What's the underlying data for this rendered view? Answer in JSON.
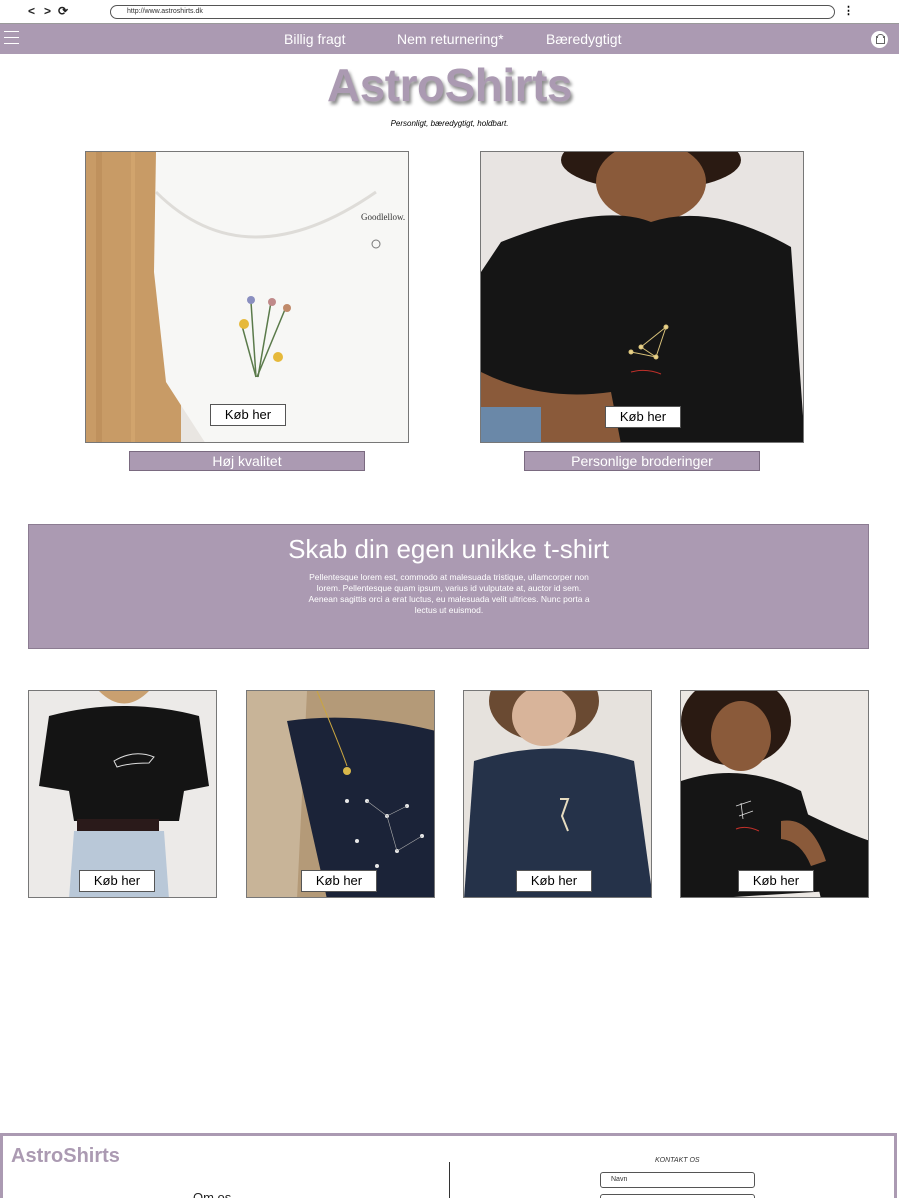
{
  "browser": {
    "back": "<",
    "forward": ">",
    "reload": "⟳",
    "url": "http://www.astroshirts.dk",
    "menu": "⋮"
  },
  "nav": {
    "links": [
      "Billig fragt",
      "Nem returnering*",
      "Bæredygtigt"
    ]
  },
  "brand": {
    "logo": "AstroShirts",
    "tagline": "Personligt, bæredygtigt, holdbart."
  },
  "featured": [
    {
      "button": "Køb her",
      "caption": "Høj kvalitet"
    },
    {
      "button": "Køb her",
      "caption": "Personlige broderinger"
    }
  ],
  "banner": {
    "title": "Skab din egen unikke t-shirt",
    "body": "Pellentesque lorem est, commodo at malesuada tristique, ullamcorper non lorem. Pellentesque quam ipsum, varius id vulputate at, auctor id sem. Aenean sagittis orci a erat luctus, eu malesuada velit ultrices. Nunc porta a lectus ut euismod."
  },
  "products": [
    {
      "button": "Køb her"
    },
    {
      "button": "Køb her"
    },
    {
      "button": "Køb her"
    },
    {
      "button": "Køb her"
    }
  ],
  "footer": {
    "logo": "AstroShirts",
    "about": "Om os",
    "contact_title": "KONTAKT OS",
    "name_placeholder": "Navn"
  },
  "colors": {
    "accent": "#ab9ab2"
  },
  "icons": [
    "back-icon",
    "forward-icon",
    "reload-icon",
    "kebab-menu-icon",
    "hamburger-icon",
    "shopping-bag-icon"
  ]
}
